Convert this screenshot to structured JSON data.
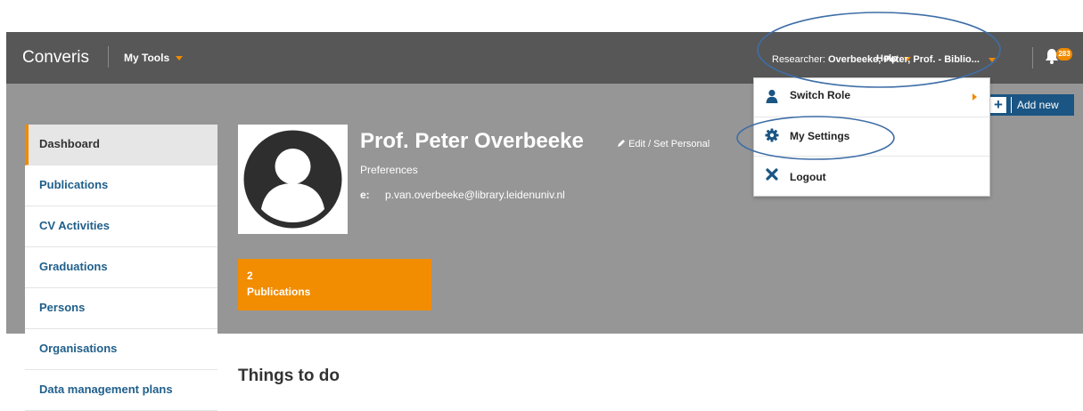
{
  "app": {
    "brand": "Converis",
    "my_tools_label": "My Tools"
  },
  "header": {
    "help_label": "Help",
    "researcher_prefix": "Researcher:",
    "researcher_name": "Overbeeke, Peter, Prof. - Biblio...",
    "notifications_count": "283"
  },
  "sidebar": {
    "items": [
      {
        "label": "Dashboard",
        "active": true
      },
      {
        "label": "Publications"
      },
      {
        "label": "CV Activities"
      },
      {
        "label": "Graduations"
      },
      {
        "label": "Persons"
      },
      {
        "label": "Organisations"
      },
      {
        "label": "Data management plans"
      }
    ]
  },
  "profile": {
    "name": "Prof. Peter Overbeeke",
    "edit_label": "Edit / Set Personal",
    "preferences_label": "Preferences",
    "email_label": "e:",
    "email": "p.van.overbeeke@library.leidenuniv.nl"
  },
  "tile": {
    "count": "2",
    "label": "Publications"
  },
  "toolbar": {
    "add_new_label": "Add new"
  },
  "role_menu": {
    "items": [
      {
        "label": "Switch Role",
        "icon": "user-icon"
      },
      {
        "label": "My Settings",
        "icon": "gear-icon"
      },
      {
        "label": "Logout",
        "icon": "close-icon"
      }
    ]
  },
  "main": {
    "things_to_do_heading": "Things to do"
  },
  "colors": {
    "accent": "#f08a00",
    "link": "#1f5f8b",
    "header_bg": "#575757",
    "banner_bg": "#969696",
    "primary_button": "#1a5583",
    "callout": "#3e6ea7"
  }
}
